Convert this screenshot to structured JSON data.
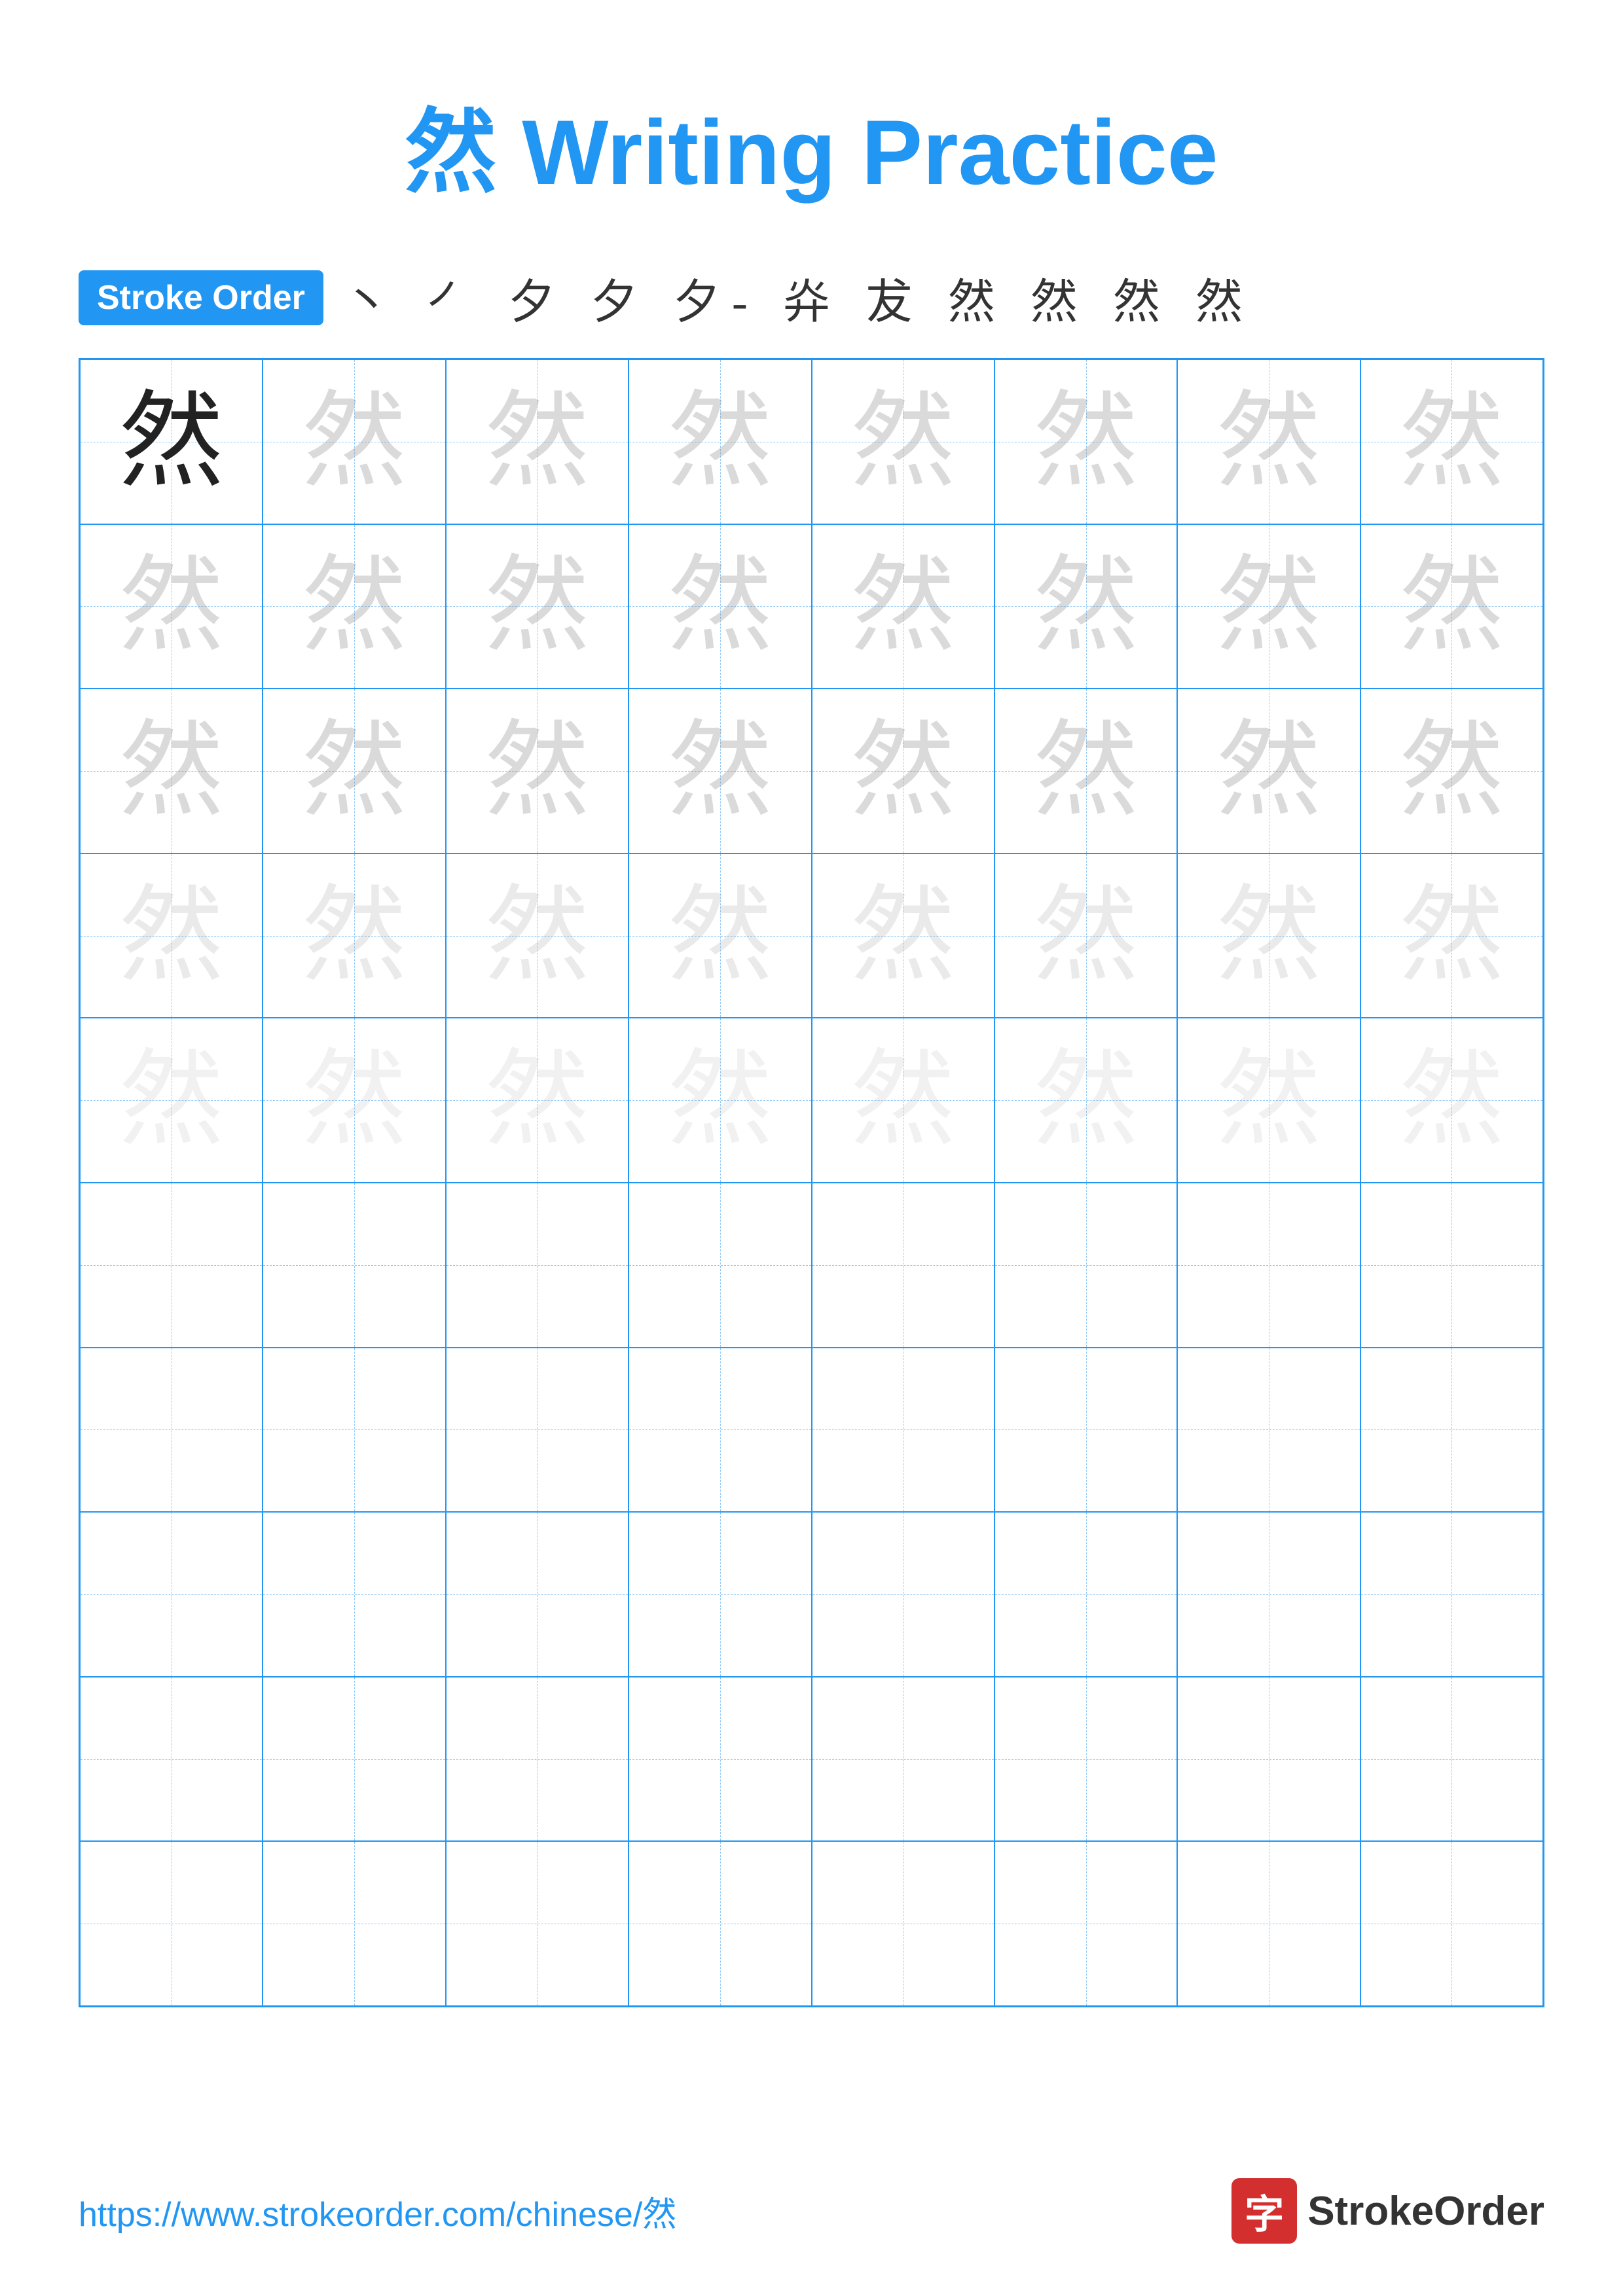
{
  "title": "然 Writing Practice",
  "stroke_order_label": "Stroke Order",
  "stroke_sequence": "丶 ㇒ 夕 夕 夕- 灷 犮 然 然 然 然",
  "character": "然",
  "footer_url": "https://www.strokeorder.com/chinese/然",
  "footer_brand": "StrokeOrder",
  "footer_icon": "字",
  "rows": [
    {
      "opacity_class": "char-dark",
      "count": 1
    },
    {
      "opacity_class": "char-light-1",
      "count": 7
    },
    {
      "opacity_class": "char-light-1",
      "count": 8
    },
    {
      "opacity_class": "char-light-1",
      "count": 8
    },
    {
      "opacity_class": "char-light-2",
      "count": 8
    },
    {
      "opacity_class": "char-light-3",
      "count": 8
    },
    {
      "opacity_class": "empty",
      "count": 8
    },
    {
      "opacity_class": "empty",
      "count": 8
    },
    {
      "opacity_class": "empty",
      "count": 8
    },
    {
      "opacity_class": "empty",
      "count": 8
    }
  ]
}
